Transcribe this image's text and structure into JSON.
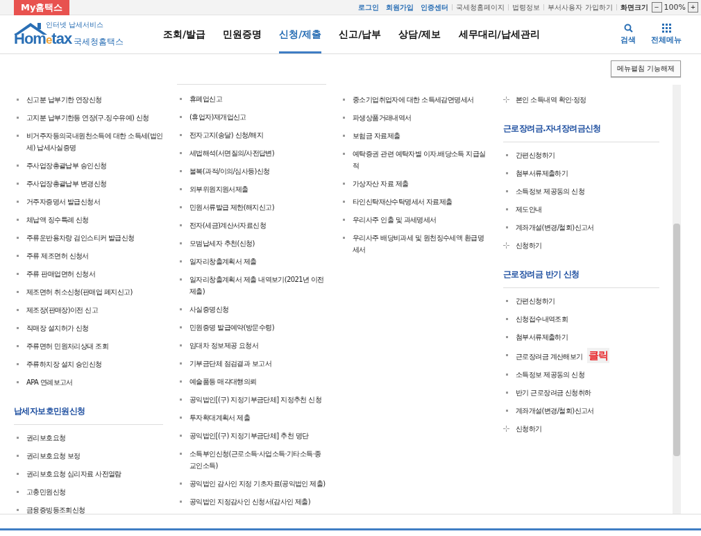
{
  "top_bar": {
    "brand_tab": "My홈택스",
    "links": [
      {
        "label": "로그인",
        "emphasis": true
      },
      {
        "label": "회원가입",
        "emphasis": true
      },
      {
        "label": "인증센터",
        "emphasis": true
      },
      {
        "label": "국세청홈페이지",
        "emphasis": false
      },
      {
        "label": "법령정보",
        "emphasis": false
      },
      {
        "label": "부서사용자 가입하기",
        "emphasis": false
      }
    ],
    "zoom": {
      "label": "화면크기",
      "minus": "−",
      "value": "100%",
      "plus": "+"
    }
  },
  "header": {
    "logo": {
      "tagline": "인터넷 납세서비스",
      "wordmark_left": "Hom",
      "wordmark_e": "e",
      "wordmark_right": "tax",
      "name": "국세청홈택스"
    },
    "nav": [
      {
        "label": "조회/발급",
        "selected": false
      },
      {
        "label": "민원증명",
        "selected": false
      },
      {
        "label": "신청/제출",
        "selected": true
      },
      {
        "label": "신고/납부",
        "selected": false
      },
      {
        "label": "상담/제보",
        "selected": false
      },
      {
        "label": "세무대리/납세관리",
        "selected": false
      }
    ],
    "tools": [
      {
        "kind": "search",
        "label": "검색"
      },
      {
        "kind": "grid",
        "label": "전체메뉴"
      }
    ]
  },
  "toggle_button": "메뉴펼침 기능해제",
  "columns": [
    {
      "top_rule": false,
      "sections": [
        {
          "items": [
            {
              "kind": "bullet",
              "label": "신고분 납부기한 연장신청"
            },
            {
              "kind": "bullet",
              "label": "고지분 납부기한등 연장(구.징수유예) 신청"
            },
            {
              "kind": "bullet",
              "label": "비거주자등의국내원천소득에 대한 소득세(법인세) 납세사실증명"
            },
            {
              "kind": "bullet",
              "label": "주사업장총괄납부 승인신청"
            },
            {
              "kind": "bullet",
              "label": "주사업장총괄납부 변경신청"
            },
            {
              "kind": "bullet",
              "label": "거주자증명서 발급신청서"
            },
            {
              "kind": "bullet",
              "label": "체납액 징수특례 신청"
            },
            {
              "kind": "bullet",
              "label": "주류운반용차량 검인스티커 발급신청"
            },
            {
              "kind": "bullet",
              "label": "주류 제조면허 신청서"
            },
            {
              "kind": "bullet",
              "label": "주류 판매업면허 신청서"
            },
            {
              "kind": "bullet",
              "label": "제조면허 취소신청(판매업 폐지신고)"
            },
            {
              "kind": "bullet",
              "label": "제조장(판매장)이전 신고"
            },
            {
              "kind": "bullet",
              "label": "직매장 설치허가 신청"
            },
            {
              "kind": "bullet",
              "label": "주류면허 민원처리상태 조회"
            },
            {
              "kind": "bullet",
              "label": "주류하치장 설치 승인신청"
            },
            {
              "kind": "bullet",
              "label": "APA 연례보고서"
            }
          ]
        },
        {
          "title": "납세자보호민원신청",
          "items": [
            {
              "kind": "bullet",
              "label": "권리보호요청"
            },
            {
              "kind": "bullet",
              "label": "권리보호요청 보정"
            },
            {
              "kind": "bullet",
              "label": "권리보호요청 심리자료 사전열람"
            },
            {
              "kind": "bullet",
              "label": "고충민원신청"
            },
            {
              "kind": "bullet",
              "label": "금융증빙등조회신청"
            }
          ]
        }
      ]
    },
    {
      "top_rule": true,
      "sections": [
        {
          "items": [
            {
              "kind": "bullet",
              "label": "휴폐업신고"
            },
            {
              "kind": "bullet",
              "label": "(휴업자)재개업신고"
            },
            {
              "kind": "bullet",
              "label": "전자고지(송달) 신청/해지"
            },
            {
              "kind": "bullet",
              "label": "세법해석(서면질의/사전답변)"
            },
            {
              "kind": "bullet",
              "label": "불복(과적/이의/심사등)신청"
            },
            {
              "kind": "bullet",
              "label": "외부위원지원서제출"
            },
            {
              "kind": "bullet",
              "label": "민원서류발급 제한(해지신고)"
            },
            {
              "kind": "bullet",
              "label": "전자(세금)계산서자료신청"
            },
            {
              "kind": "bullet",
              "label": "모범납세자 추천(신청)"
            },
            {
              "kind": "bullet",
              "label": "일자리창출계획서 제출"
            },
            {
              "kind": "bullet",
              "label": "일자리창출계획서 제출 내역보기(2021년 이전 제출)"
            },
            {
              "kind": "bullet",
              "label": "사실증명신청"
            },
            {
              "kind": "bullet",
              "label": "민원증명 발급예약(방문수령)"
            },
            {
              "kind": "bullet",
              "label": "임대차 정보제공 요청서"
            },
            {
              "kind": "bullet",
              "label": "기부금단체 점검결과 보고서"
            },
            {
              "kind": "bullet",
              "label": "예술품등 매각대행의뢰"
            },
            {
              "kind": "bullet",
              "label": "공익법인[(구) 지정기부금단체] 지정추천 신청"
            },
            {
              "kind": "bullet",
              "label": "투자확대계획서 제출"
            },
            {
              "kind": "bullet",
              "label": "공익법인[(구) 지정기부금단체] 추천 명단"
            },
            {
              "kind": "bullet",
              "label": "소득부인신청(근로소득·사업소득·기타소득·종교인소득)"
            },
            {
              "kind": "bullet",
              "label": "공익법인 감사인 지정 기초자료(공익법인 제출)"
            },
            {
              "kind": "bullet",
              "label": "공익법인 지정감사인 신청서(감사인 제출)"
            }
          ]
        }
      ]
    },
    {
      "top_rule": false,
      "sections": [
        {
          "items": [
            {
              "kind": "bullet",
              "label": "중소기업취업자에 대한 소득세감면명세서"
            },
            {
              "kind": "bullet",
              "label": "파생상품거래내역서"
            },
            {
              "kind": "bullet",
              "label": "보험금 자료제출"
            },
            {
              "kind": "bullet",
              "label": "예탁증권 관련 예탁자별 이자.배당소득 지급실적"
            },
            {
              "kind": "bullet",
              "label": "가상자산 자료 제출"
            },
            {
              "kind": "bullet",
              "label": "타인신탁재산수탁명세서 자료제출"
            },
            {
              "kind": "bullet",
              "label": "우리사주 인출 및 과세명세서"
            },
            {
              "kind": "bullet",
              "label": "우리사주 배당비과세 및 원천징수세액 환급명세서"
            }
          ]
        }
      ]
    },
    {
      "top_rule": false,
      "sections": [
        {
          "items": [
            {
              "kind": "plus",
              "label": "본인 소득내역 확인·정정"
            }
          ]
        },
        {
          "title": "근로장려금.자녀장려금신청",
          "items": [
            {
              "kind": "bullet",
              "label": "간편신청하기"
            },
            {
              "kind": "bullet",
              "label": "첨부서류제출하기"
            },
            {
              "kind": "bullet",
              "label": "소득정보 제공동의 신청"
            },
            {
              "kind": "bullet",
              "label": "제도안내"
            },
            {
              "kind": "bullet",
              "label": "계좌개설(변경/철회)신고서"
            },
            {
              "kind": "plus",
              "label": "신청하기"
            }
          ]
        },
        {
          "title": "근로장려금 반기 신청",
          "items": [
            {
              "kind": "bullet",
              "label": "간편신청하기"
            },
            {
              "kind": "bullet",
              "label": "신청접수내역조회"
            },
            {
              "kind": "bullet",
              "label": "첨부서류제출하기"
            },
            {
              "kind": "bullet",
              "label": "근로장려금 계산해보기",
              "note": "클릭"
            },
            {
              "kind": "bullet",
              "label": "소득정보 제공동의 신청"
            },
            {
              "kind": "bullet",
              "label": "반기 근로장려금 신청취하"
            },
            {
              "kind": "bullet",
              "label": "계좌개설(변경/철회)신고서"
            },
            {
              "kind": "plus",
              "label": "신청하기"
            }
          ]
        }
      ]
    }
  ]
}
